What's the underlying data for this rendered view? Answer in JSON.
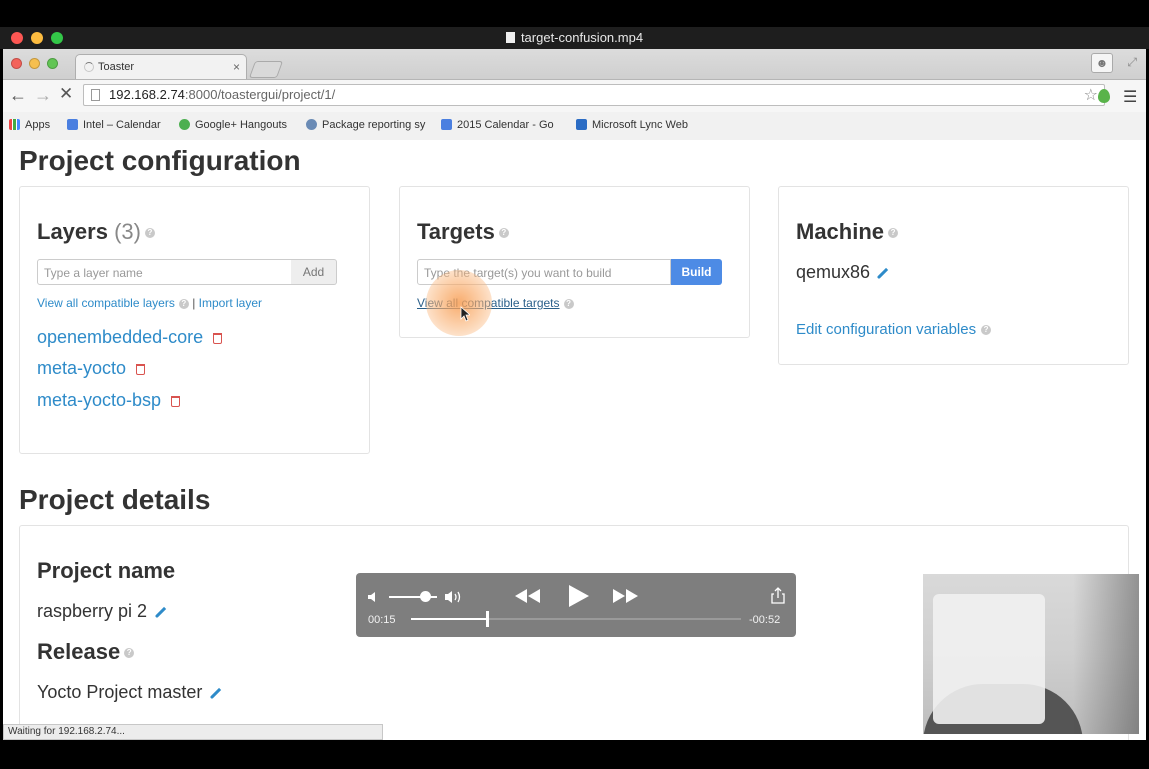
{
  "window": {
    "title": "target-confusion.mp4"
  },
  "browser": {
    "tab_title": "Toaster",
    "tab_close": "×",
    "url_host": "192.168.2.74",
    "url_rest": ":8000/toastergui/project/1/",
    "bookmarks": [
      {
        "label": "Apps",
        "icon": "apps-grid-icon"
      },
      {
        "label": "Intel – Calendar",
        "icon": "google-calendar-icon"
      },
      {
        "label": "Google+ Hangouts",
        "icon": "hangouts-icon"
      },
      {
        "label": "Package reporting sy",
        "icon": "package-icon"
      },
      {
        "label": "2015 Calendar - Go",
        "icon": "docs-icon"
      },
      {
        "label": "Microsoft Lync Web",
        "icon": "lync-icon"
      }
    ],
    "status_text": "Waiting for 192.168.2.74..."
  },
  "project_configuration": {
    "heading": "Project configuration",
    "layers": {
      "title": "Layers",
      "count": "(3)",
      "input_placeholder": "Type a layer name",
      "add_label": "Add",
      "view_all_label": "View all compatible layers",
      "separator": "|",
      "import_label": "Import layer",
      "items": [
        "openembedded-core",
        "meta-yocto",
        "meta-yocto-bsp"
      ]
    },
    "targets": {
      "title": "Targets",
      "input_placeholder": "Type the target(s) you want to build",
      "build_label": "Build",
      "view_all_label": "View all compatible targets"
    },
    "machine": {
      "title": "Machine",
      "value": "qemux86",
      "edit_vars_label": "Edit configuration variables"
    }
  },
  "project_details": {
    "heading": "Project details",
    "name_label": "Project name",
    "name_value": "raspberry pi 2",
    "release_label": "Release",
    "release_value": "Yocto Project master"
  },
  "player": {
    "elapsed": "00:15",
    "remaining": "-00:52",
    "progress": 0.23,
    "volume": 0.75
  },
  "colors": {
    "link": "#2e8bc9",
    "build_button": "#4d8be5",
    "delete": "#d9534f",
    "heading": "#333333"
  }
}
